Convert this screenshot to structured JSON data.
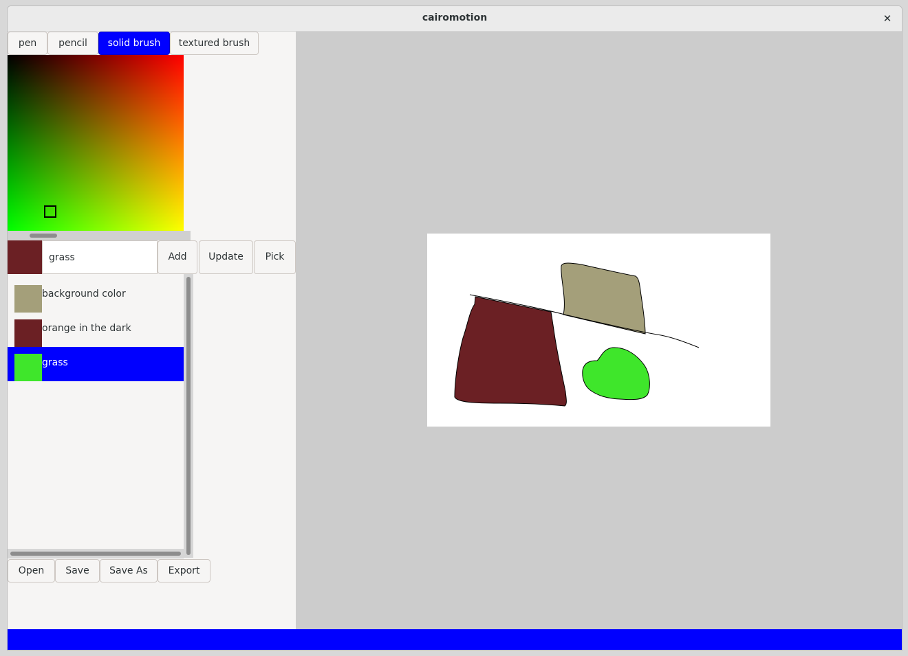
{
  "window": {
    "title": "cairomotion",
    "close_glyph": "✕"
  },
  "tool_tabs": [
    {
      "label": "pen",
      "active": false
    },
    {
      "label": "pencil",
      "active": false
    },
    {
      "label": "solid brush",
      "active": true
    },
    {
      "label": "textured brush",
      "active": false
    }
  ],
  "color_picker": {
    "corner_colors": {
      "top_left": "#000000",
      "top_right": "#ff0000",
      "bottom_left": "#00ff00",
      "bottom_right": "#ffff00"
    }
  },
  "editor": {
    "current_color": "#6b2024",
    "name_value": "grass",
    "add_label": "Add",
    "update_label": "Update",
    "pick_label": "Pick"
  },
  "palette": [
    {
      "label": "background color",
      "color": "#a49f7a",
      "selected": false
    },
    {
      "label": "orange in the dark",
      "color": "#6b2024",
      "selected": false
    },
    {
      "label": "grass",
      "color": "#3fe62b",
      "selected": true
    }
  ],
  "file_buttons": {
    "open": "Open",
    "save": "Save",
    "save_as": "Save As",
    "export": "Export"
  },
  "canvas": {
    "background": "#cccccc",
    "paper": "#ffffff",
    "shapes": [
      {
        "name": "brown-shape",
        "fill": "#6b2024"
      },
      {
        "name": "khaki-shape",
        "fill": "#a49f7a"
      },
      {
        "name": "green-blob",
        "fill": "#3fe62b"
      }
    ]
  },
  "statusbar": {
    "color": "#0000ff"
  }
}
